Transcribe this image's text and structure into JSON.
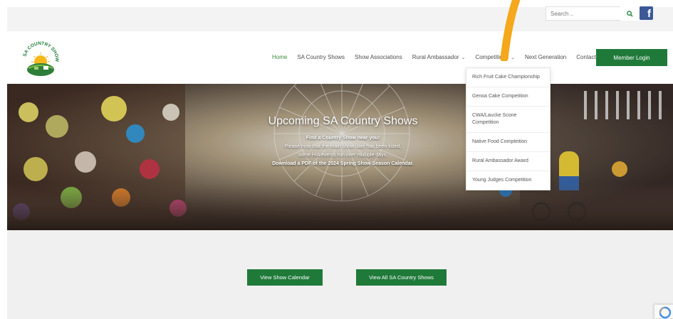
{
  "topbar": {
    "search_placeholder": "Search ..",
    "search_icon": "search-icon",
    "social_icon": "facebook-icon",
    "facebook_letter": "f"
  },
  "header": {
    "logo_text": "SA COUNTRY SHOWS",
    "nav": [
      {
        "label": "Home"
      },
      {
        "label": "SA Country Shows"
      },
      {
        "label": "Show Associations"
      },
      {
        "label": "Rural Ambassador"
      },
      {
        "label": "Competitions"
      },
      {
        "label": "Next Generation"
      },
      {
        "label": "Contact"
      }
    ],
    "login_label": "Member Login"
  },
  "dropdown": {
    "items": [
      "Rich Fruit Cake Championship",
      "Genoa Cake Competition",
      "CWA/Laucke Scone Competition",
      "Native Food Compteition",
      "Rural Ambassador Award",
      "Young Judges Competition"
    ]
  },
  "hero": {
    "title": "Upcoming SA Country Shows",
    "line1": "Find a Country Show near you!",
    "line2": "Please note that the main show date has been listed,",
    "line3": "some HIA events run over multiple days.",
    "link": "Download a PDF of the 2024 Spring Show Season Calendar."
  },
  "cta": {
    "calendar": "View Show Calendar",
    "all_shows": "View All SA Country Shows"
  },
  "colors": {
    "brand_green": "#1f7a3a",
    "active_nav": "#3b8a3e",
    "marker_yellow": "#f5a81c",
    "facebook": "#3b5998"
  }
}
